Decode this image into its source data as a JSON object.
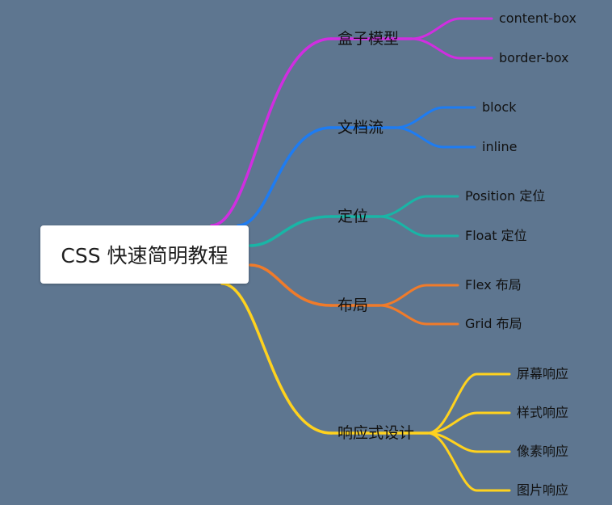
{
  "root": {
    "label": "CSS 快速简明教程"
  },
  "colors": {
    "background": "#5e7690",
    "magenta": "#d02ee0",
    "blue": "#1e7cf2",
    "teal": "#19b5a6",
    "orange": "#f07b2a",
    "yellow": "#ffd21e"
  },
  "branches": [
    {
      "label": "盒子模型",
      "color": "#d02ee0",
      "children": [
        "content-box",
        "border-box"
      ]
    },
    {
      "label": "文档流",
      "color": "#1e7cf2",
      "children": [
        "block",
        "inline"
      ]
    },
    {
      "label": "定位",
      "color": "#19b5a6",
      "children": [
        "Position 定位",
        "Float 定位"
      ]
    },
    {
      "label": "布局",
      "color": "#f07b2a",
      "children": [
        "Flex 布局",
        "Grid 布局"
      ]
    },
    {
      "label": "响应式设计",
      "color": "#ffd21e",
      "children": [
        "屏幕响应",
        "样式响应",
        "像素响应",
        "图片响应"
      ]
    }
  ]
}
